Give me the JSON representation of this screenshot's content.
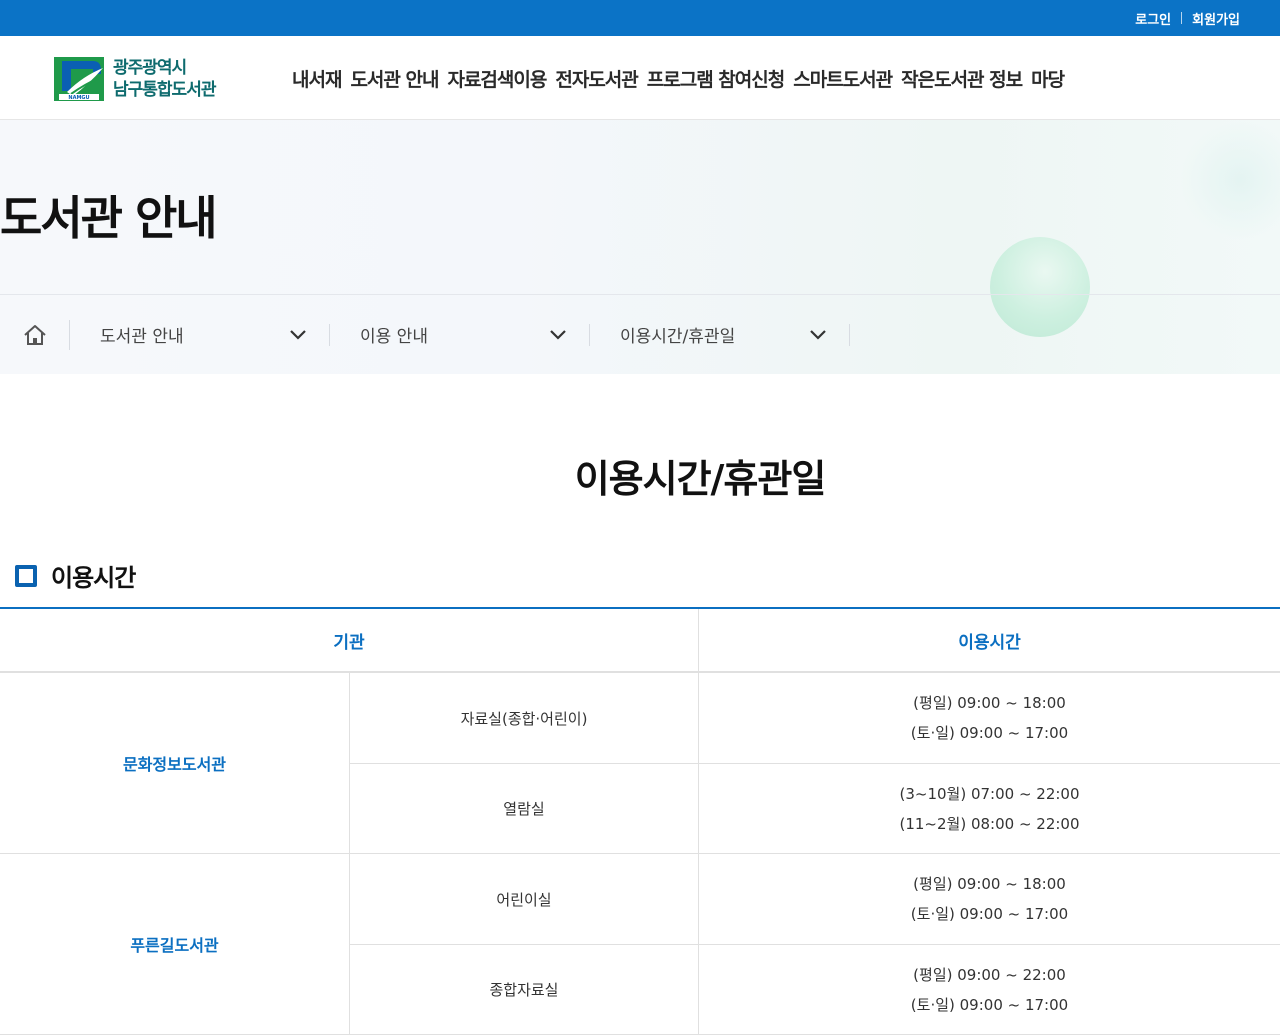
{
  "topbar": {
    "login": "로그인",
    "signup": "회원가입"
  },
  "logo": {
    "line1": "광주광역시",
    "line2": "남구통합도서관",
    "mark_sub": "NAMGU",
    "colors": {
      "blue": "#0a5fb3",
      "green": "#1f9a4a"
    }
  },
  "gnb": [
    "내서재",
    "도서관 안내",
    "자료검색이용",
    "전자도서관",
    "프로그램 참여신청",
    "스마트도서관",
    "작은도서관 정보",
    "마당"
  ],
  "visual": {
    "heading": "도서관 안내"
  },
  "breadcrumb": {
    "home": "home-icon",
    "items": [
      "도서관 안내",
      "이용 안내",
      "이용시간/휴관일"
    ]
  },
  "content": {
    "title": "이용시간/휴관일",
    "section": "이용시간"
  },
  "table": {
    "headers": [
      "기관",
      "이용시간"
    ],
    "groups": [
      {
        "org": "문화정보도서관",
        "rows": [
          {
            "room": "자료실(종합·어린이)",
            "hours": [
              "(평일) 09:00 ~ 18:00",
              "(토·일) 09:00 ~ 17:00"
            ]
          },
          {
            "room": "열람실",
            "hours": [
              "(3~10월) 07:00 ~ 22:00",
              "(11~2월) 08:00 ~ 22:00"
            ]
          }
        ]
      },
      {
        "org": "푸른길도서관",
        "rows": [
          {
            "room": "어린이실",
            "hours": [
              "(평일) 09:00 ~ 18:00",
              "(토·일) 09:00 ~ 17:00"
            ]
          },
          {
            "room": "종합자료실",
            "hours": [
              "(평일) 09:00 ~ 22:00",
              "(토·일) 09:00 ~ 17:00"
            ]
          }
        ]
      }
    ]
  },
  "colors": {
    "primary": "#0b73c6",
    "accent_text": "#0b6fc1"
  }
}
